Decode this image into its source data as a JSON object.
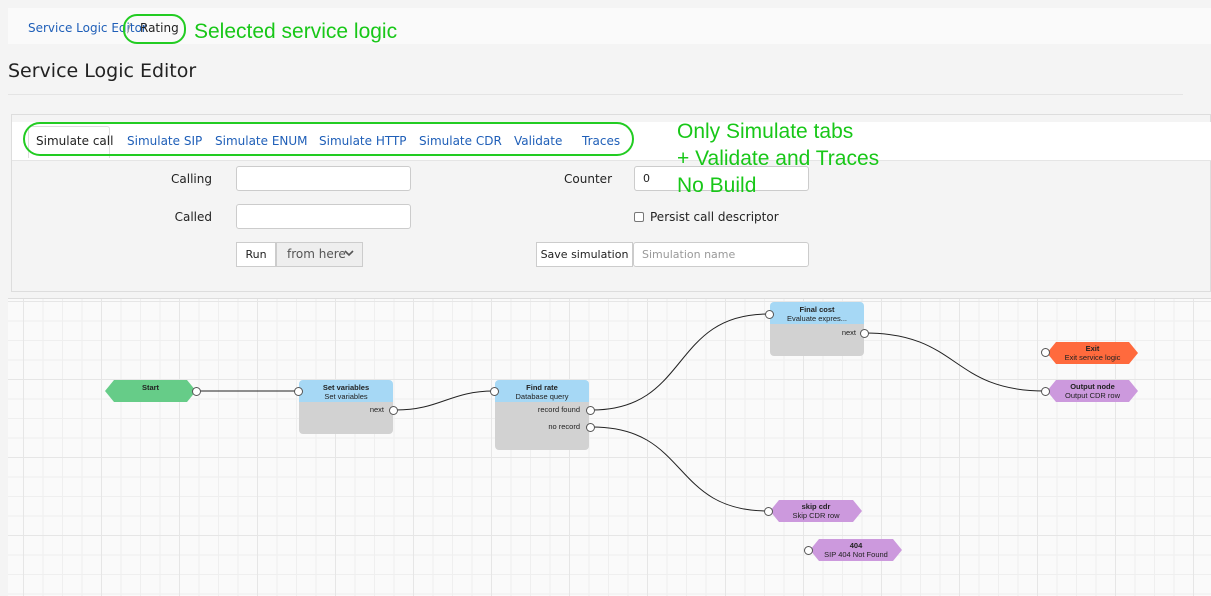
{
  "breadcrumb": {
    "link_label": "Service Logic Editor",
    "separator": "/",
    "current_label": "Rating"
  },
  "annotations": {
    "selected_logic": "Selected service logic",
    "tabs_note_line1": "Only Simulate tabs",
    "tabs_note_line2": "+ Validate and Traces",
    "tabs_note_line3": "No Build"
  },
  "page_title": "Service Logic Editor",
  "tabs": [
    {
      "label": "Simulate call",
      "active": true
    },
    {
      "label": "Simulate SIP",
      "active": false
    },
    {
      "label": "Simulate ENUM",
      "active": false
    },
    {
      "label": "Simulate HTTP",
      "active": false
    },
    {
      "label": "Simulate CDR",
      "active": false
    },
    {
      "label": "Validate",
      "active": false
    },
    {
      "label": "Traces",
      "active": false
    }
  ],
  "form": {
    "calling_label": "Calling",
    "calling_value": "",
    "called_label": "Called",
    "called_value": "",
    "counter_label": "Counter",
    "counter_value": "0",
    "persist_label": "Persist call descriptor",
    "persist_checked": false,
    "run_label": "Run",
    "run_mode_selected": "from here",
    "save_simulation_label": "Save simulation",
    "simulation_name_placeholder": "Simulation name"
  },
  "flow": {
    "nodes": {
      "start": {
        "title": "Start",
        "color": "#66cc88"
      },
      "set_variables": {
        "title": "Set variables",
        "subtitle": "Set variables",
        "outputs": [
          "next"
        ]
      },
      "find_rate": {
        "title": "Find rate",
        "subtitle": "Database query",
        "outputs": [
          "record found",
          "no record"
        ]
      },
      "final_cost": {
        "title": "Final cost",
        "subtitle": "Evaluate expres...",
        "outputs": [
          "next"
        ]
      },
      "exit": {
        "title": "Exit",
        "subtitle": "Exit service logic",
        "color": "#ff6a3d"
      },
      "output_node": {
        "title": "Output node",
        "subtitle": "Output CDR row",
        "color": "#cc99dd"
      },
      "skip_cdr": {
        "title": "skip cdr",
        "subtitle": "Skip CDR row",
        "color": "#cc99dd"
      },
      "sip_404": {
        "title": "404",
        "subtitle": "SIP 404 Not Found",
        "color": "#cc99dd"
      }
    },
    "colors": {
      "header": "#a6d8f5",
      "body": "#d2d2d2",
      "highlight": "#22cc22"
    }
  }
}
